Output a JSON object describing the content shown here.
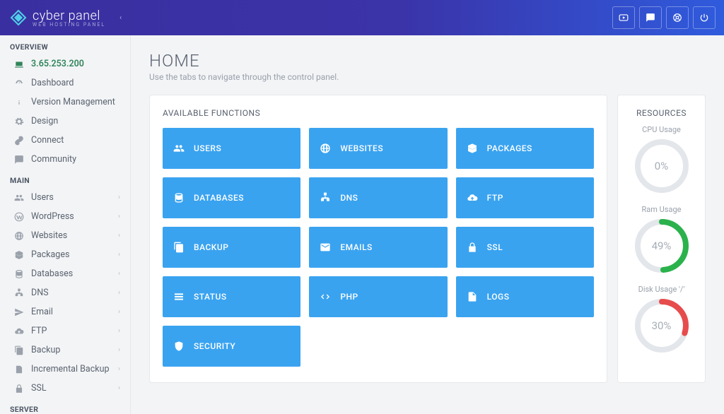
{
  "brand": {
    "name": "cyber panel",
    "tagline": "WEB HOSTING PANEL"
  },
  "page": {
    "title": "HOME",
    "subtitle": "Use the tabs to navigate through the control panel."
  },
  "sidebar": {
    "sections": [
      {
        "header": "OVERVIEW",
        "items": [
          {
            "label": "3.65.253.200",
            "icon": "laptop",
            "active": true
          },
          {
            "label": "Dashboard",
            "icon": "gauge"
          },
          {
            "label": "Version Management",
            "icon": "info"
          },
          {
            "label": "Design",
            "icon": "gear"
          },
          {
            "label": "Connect",
            "icon": "link"
          },
          {
            "label": "Community",
            "icon": "chat"
          }
        ]
      },
      {
        "header": "MAIN",
        "items": [
          {
            "label": "Users",
            "icon": "users",
            "expandable": true
          },
          {
            "label": "WordPress",
            "icon": "wordpress",
            "expandable": true
          },
          {
            "label": "Websites",
            "icon": "globe",
            "expandable": true
          },
          {
            "label": "Packages",
            "icon": "boxes",
            "expandable": true
          },
          {
            "label": "Databases",
            "icon": "db",
            "expandable": true
          },
          {
            "label": "DNS",
            "icon": "sitemap",
            "expandable": true
          },
          {
            "label": "Email",
            "icon": "send",
            "expandable": true
          },
          {
            "label": "FTP",
            "icon": "cloud-up",
            "expandable": true
          },
          {
            "label": "Backup",
            "icon": "copy",
            "expandable": true
          },
          {
            "label": "Incremental Backup",
            "icon": "inc",
            "expandable": true
          },
          {
            "label": "SSL",
            "icon": "lock",
            "expandable": true
          }
        ]
      },
      {
        "header": "SERVER",
        "items": []
      }
    ]
  },
  "functions": {
    "heading": "AVAILABLE FUNCTIONS",
    "tiles": [
      {
        "label": "USERS",
        "icon": "users"
      },
      {
        "label": "WEBSITES",
        "icon": "globe"
      },
      {
        "label": "PACKAGES",
        "icon": "boxes"
      },
      {
        "label": "DATABASES",
        "icon": "db"
      },
      {
        "label": "DNS",
        "icon": "sitemap"
      },
      {
        "label": "FTP",
        "icon": "cloud-up"
      },
      {
        "label": "BACKUP",
        "icon": "copy"
      },
      {
        "label": "EMAILS",
        "icon": "mail"
      },
      {
        "label": "SSL",
        "icon": "lock"
      },
      {
        "label": "STATUS",
        "icon": "bars"
      },
      {
        "label": "PHP",
        "icon": "code"
      },
      {
        "label": "LOGS",
        "icon": "file"
      },
      {
        "label": "SECURITY",
        "icon": "shield"
      }
    ]
  },
  "resources": {
    "heading": "RESOURCES",
    "gauges": [
      {
        "label": "CPU Usage",
        "percent": 0,
        "color": "#cfd4da"
      },
      {
        "label": "Ram Usage",
        "percent": 49,
        "color": "#2bb24c"
      },
      {
        "label": "Disk Usage '/'",
        "percent": 30,
        "color": "#e74c4c"
      }
    ]
  },
  "topbar_icons": [
    "youtube",
    "chat",
    "support",
    "power"
  ]
}
